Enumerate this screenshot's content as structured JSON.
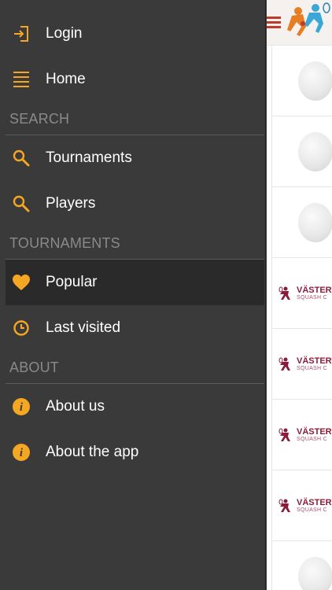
{
  "menu": {
    "login_label": "Login",
    "home_label": "Home",
    "search_header": "SEARCH",
    "tournaments_label": "Tournaments",
    "players_label": "Players",
    "tournaments_header": "TOURNAMENTS",
    "popular_label": "Popular",
    "last_visited_label": "Last visited",
    "about_header": "ABOUT",
    "about_us_label": "About us",
    "about_app_label": "About the app"
  },
  "logo": {
    "line1": "VÄSTER",
    "line2": "SQUASH C"
  },
  "colors": {
    "accent": "#f5a623",
    "drawer_bg": "#3a3a3a",
    "active_bg": "#2a2a2a",
    "brand": "#8a1c3b"
  },
  "icons": {
    "login": "login-icon",
    "home": "list-icon",
    "search": "search-icon",
    "popular": "heart-icon",
    "recent": "clock-icon",
    "info": "info-icon",
    "hamburger": "hamburger-icon"
  }
}
